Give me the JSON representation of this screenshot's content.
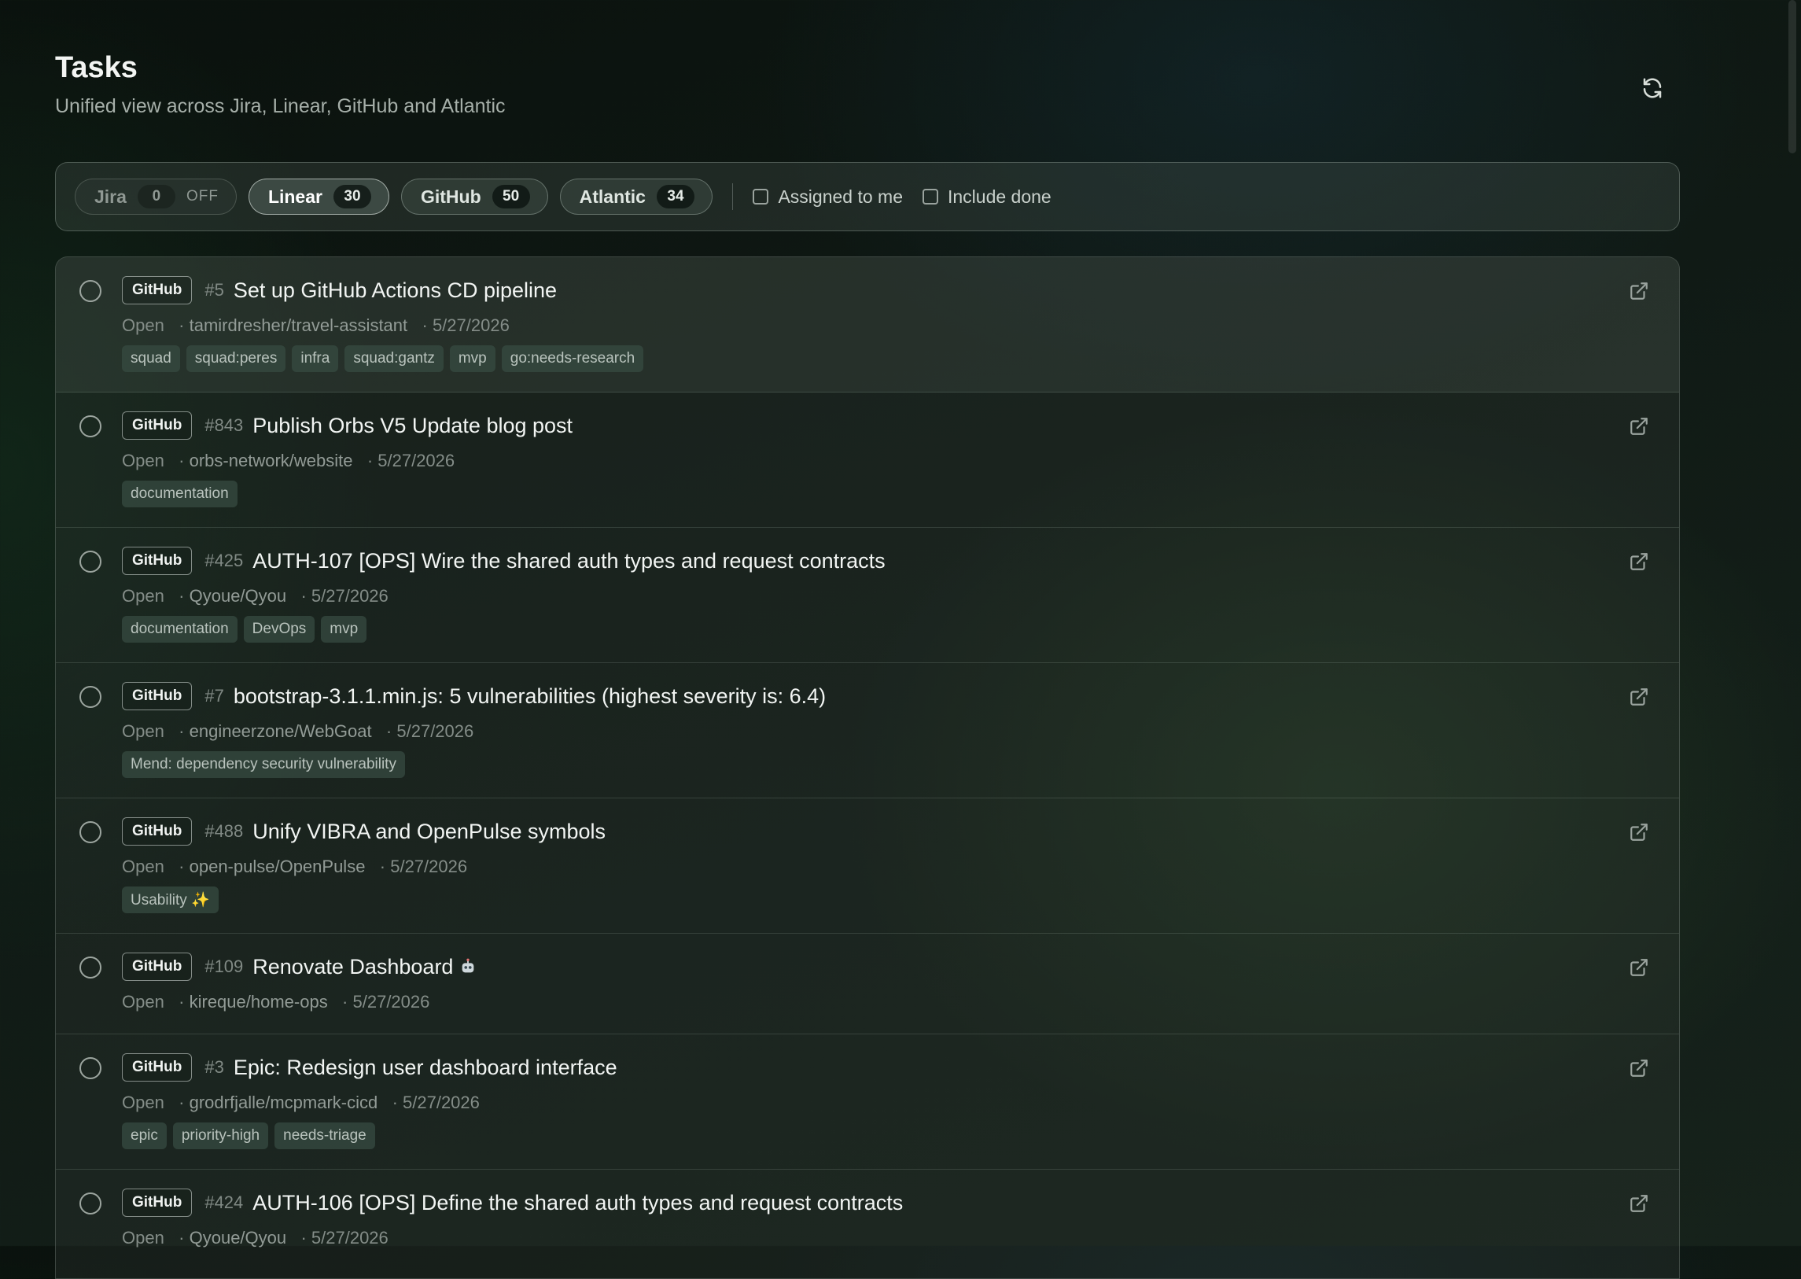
{
  "header": {
    "title": "Tasks",
    "subtitle": "Unified view across Jira, Linear, GitHub and Atlantic"
  },
  "toolbar": {
    "sources": [
      {
        "label": "Jira",
        "count": "0",
        "status": "OFF"
      },
      {
        "label": "Linear",
        "count": "30"
      },
      {
        "label": "GitHub",
        "count": "50"
      },
      {
        "label": "Atlantic",
        "count": "34"
      }
    ],
    "assigned_label": "Assigned to me",
    "include_done_label": "Include done"
  },
  "tasks": [
    {
      "source": "GitHub",
      "number": "#5",
      "title": "Set up GitHub Actions CD pipeline",
      "status": "Open",
      "repo": "tamirdresher/travel-assistant",
      "date": "5/27/2026",
      "labels": [
        "squad",
        "squad:peres",
        "infra",
        "squad:gantz",
        "mvp",
        "go:needs-research"
      ]
    },
    {
      "source": "GitHub",
      "number": "#843",
      "title": "Publish Orbs V5 Update blog post",
      "status": "Open",
      "repo": "orbs-network/website",
      "date": "5/27/2026",
      "labels": [
        "documentation"
      ]
    },
    {
      "source": "GitHub",
      "number": "#425",
      "title": "AUTH-107 [OPS] Wire the shared auth types and request contracts",
      "status": "Open",
      "repo": "Qyoue/Qyou",
      "date": "5/27/2026",
      "labels": [
        "documentation",
        "DevOps",
        "mvp"
      ]
    },
    {
      "source": "GitHub",
      "number": "#7",
      "title": "bootstrap-3.1.1.min.js: 5 vulnerabilities (highest severity is: 6.4)",
      "status": "Open",
      "repo": "engineerzone/WebGoat",
      "date": "5/27/2026",
      "labels": [
        "Mend: dependency security vulnerability"
      ]
    },
    {
      "source": "GitHub",
      "number": "#488",
      "title": "Unify VIBRA and OpenPulse symbols",
      "status": "Open",
      "repo": "open-pulse/OpenPulse",
      "date": "5/27/2026",
      "labels": [
        "Usability ✨"
      ]
    },
    {
      "source": "GitHub",
      "number": "#109",
      "title": "Renovate Dashboard",
      "status": "Open",
      "repo": "kireque/home-ops",
      "date": "5/27/2026",
      "labels": [],
      "emoji": "robot-icon"
    },
    {
      "source": "GitHub",
      "number": "#3",
      "title": "Epic: Redesign user dashboard interface",
      "status": "Open",
      "repo": "grodrfjalle/mcpmark-cicd",
      "date": "5/27/2026",
      "labels": [
        "epic",
        "priority-high",
        "needs-triage"
      ]
    },
    {
      "source": "GitHub",
      "number": "#424",
      "title": "AUTH-106 [OPS] Define the shared auth types and request contracts",
      "status": "Open",
      "repo": "Qyoue/Qyou",
      "date": "5/27/2026",
      "labels": []
    }
  ]
}
